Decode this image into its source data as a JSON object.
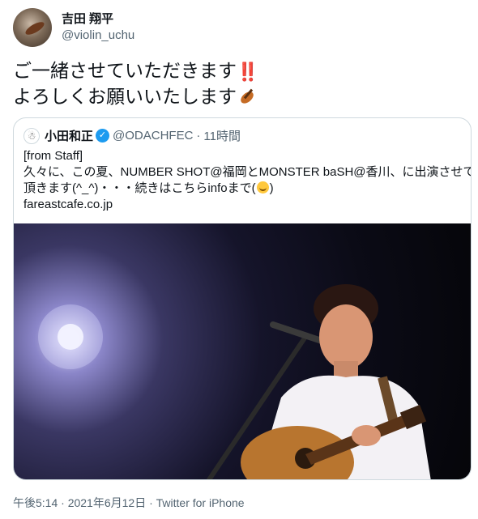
{
  "author": {
    "display_name": "吉田 翔平",
    "handle": "@violin_uchu",
    "avatar_icon": "user-avatar-violin"
  },
  "tweet": {
    "line1": "ご一緒させていただきます",
    "line1_emoji": "‼️",
    "line2": "よろしくお願いいたします",
    "line2_emoji_icon": "violin-icon"
  },
  "quoted": {
    "display_name": "小田和正",
    "handle": "@ODACHFEC",
    "separator": "·",
    "time": "11時間",
    "verified_icon": "verified-badge-icon",
    "text_line1": "[from Staff]",
    "text_line2": "久々に、この夏、NUMBER SHOT@福岡とMONSTER baSH@香川、に出演させて",
    "text_line3a": "頂きます(^_^)・・・続きはこちらinfoまで(",
    "text_line3b": ")",
    "link": "fareastcafe.co.jp",
    "photo_icon": "concert-photo"
  },
  "meta": {
    "timestamp": "午後5:14 · 2021年6月12日 · Twitter for iPhone"
  },
  "colors": {
    "verified": "#1d9bf0",
    "secondary_text": "#536471",
    "border": "#cfd9de"
  }
}
